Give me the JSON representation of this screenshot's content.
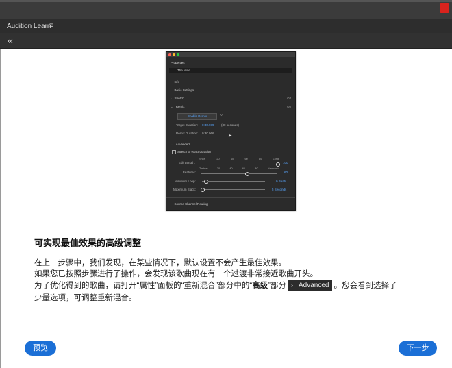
{
  "app": {
    "title": "Audition Learn",
    "menu_icon": "≡",
    "collapse_icon": "«"
  },
  "screenshot": {
    "panel_title": "Properties",
    "file_name": "The Mole",
    "sections": [
      {
        "label": "Info",
        "right": ""
      },
      {
        "label": "Basic Settings",
        "right": ""
      },
      {
        "label": "Stretch",
        "right": "Off"
      },
      {
        "label": "Remix",
        "right": "On"
      }
    ],
    "enable_button": "Enable Remix",
    "target_duration_label": "Target Duration:",
    "target_duration_value": "0:30.989",
    "target_duration_note": "(30 seconds)",
    "remix_duration_label": "Remix Duration:",
    "remix_duration_value": "0:30.966",
    "advanced_label": "Advanced",
    "stretch_label": "Stretch to exact duration",
    "edit_length_label": "Edit Length:",
    "edit_length_ticks": [
      "Short",
      "20",
      "40",
      "60",
      "80",
      "Long"
    ],
    "edit_length_value": "100",
    "features_label": "Features:",
    "features_ticks": [
      "Timbre",
      "20",
      "40",
      "60",
      "80",
      "Harmonic"
    ],
    "features_value": "60",
    "min_loop_label": "Minimum Loop:",
    "min_loop_value": "0 Beats",
    "max_slack_label": "Maximum Slack:",
    "max_slack_value": "5 Seconds",
    "source_routing_label": "Source Channel Routing",
    "edit_length_level": 1.0,
    "features_level": 0.6,
    "min_loop_level": 0.05,
    "max_slack_level": 0.0
  },
  "content": {
    "heading": "可实现最佳效果的高级调整",
    "line1": "在上一步骤中，我们发现，在某些情况下，默认设置不会产生最佳效果。",
    "line2": "如果您已按照步骤进行了操作，会发现该歌曲现在有一个过渡非常接近歌曲开头。",
    "line3_a": "为了优化得到的歌曲，请打开“属性”面板的“重新混合”部分中的“",
    "line3_bold": "高级",
    "line3_b": "”部分",
    "chip_chevron": "›",
    "chip_label": "Advanced",
    "line3_c": "。您会看到选择了",
    "line4": "少量选项，可调整重新混合。"
  },
  "nav": {
    "prev_label": "预览",
    "next_label": "下一步"
  }
}
